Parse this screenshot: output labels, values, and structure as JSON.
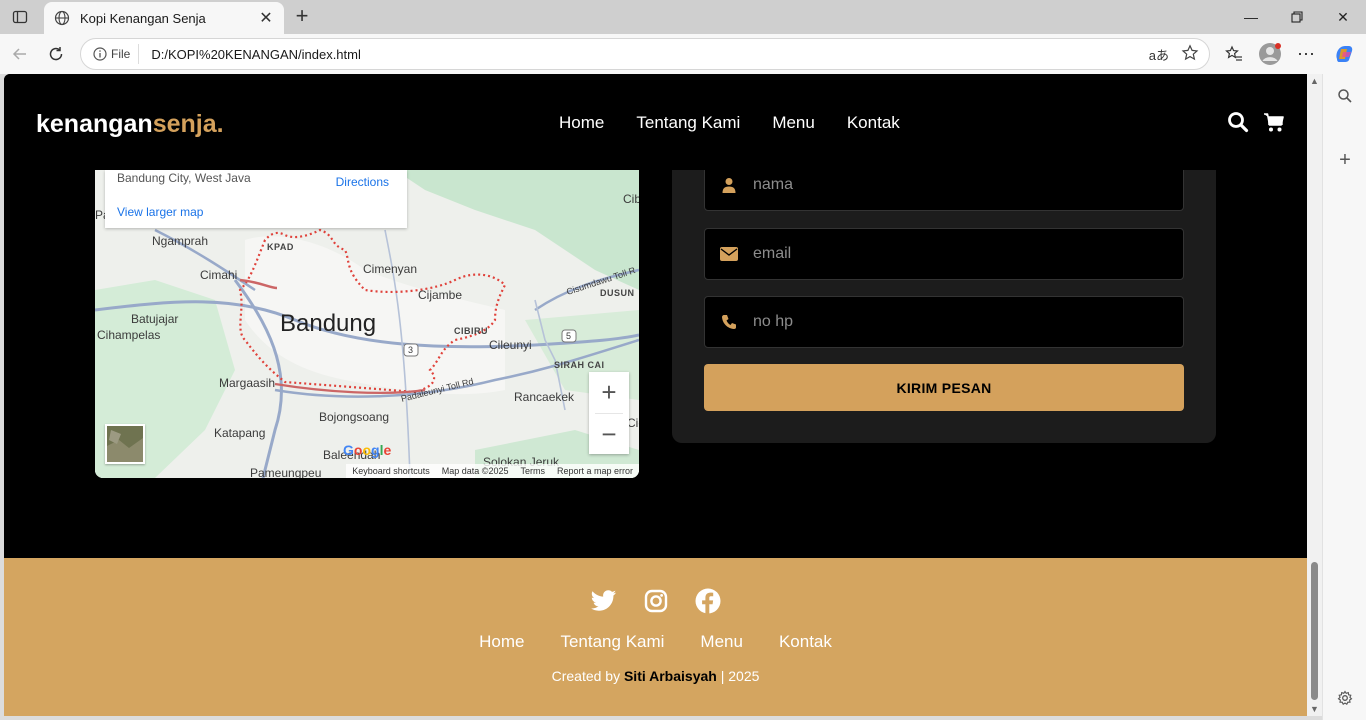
{
  "browser": {
    "tab_title": "Kopi Kenangan Senja",
    "address_label": "File",
    "url": "D:/KOPI%20KENANGAN/index.html",
    "read_aloud_glyph": "aあ"
  },
  "site": {
    "logo_main": "kenangan",
    "logo_accent": "senja.",
    "accent_color": "#d4a15c",
    "nav": [
      "Home",
      "Tentang Kami",
      "Menu",
      "Kontak"
    ]
  },
  "map": {
    "address": "Bandung City, West Java",
    "directions": "Directions",
    "larger_map": "View larger map",
    "places": {
      "pa": "Pa",
      "ngamprah": "Ngamprah",
      "kpad": "KPAD",
      "cimahi": "Cimahi",
      "cimenyan": "Cimenyan",
      "cijambe": "Cijambe",
      "bandung": "Bandung",
      "cibiru": "CIBIRU",
      "batujajar": "Batujajar",
      "cihampelas": "Cihampelas",
      "cileunyi": "Cileunyi",
      "sirah_cai": "SIRAH CAI",
      "margaasih": "Margaasih",
      "rancaekek": "Rancaekek",
      "bojongsoang": "Bojongsoang",
      "katapang": "Katapang",
      "pameungpeuk": "Pameungpeu",
      "baleendah": "Baleendah",
      "solokan_jeruk": "Solokan Jeruk",
      "cib": "Cib",
      "dusun": "DUSUN",
      "cisumdawu": "Cisumdawu Toll R",
      "padaleunyi": "Padaleunyi Toll Rd",
      "cic": "Cic",
      "route_3": "3",
      "route_5": "5"
    },
    "zoom_in": "+",
    "zoom_out": "−",
    "google": "Google",
    "attribution": [
      "Keyboard shortcuts",
      "Map data ©2025",
      "Terms",
      "Report a map error"
    ]
  },
  "form": {
    "name_placeholder": "nama",
    "email_placeholder": "email",
    "phone_placeholder": "no hp",
    "submit_label": "KIRIM PESAN"
  },
  "footer": {
    "links": [
      "Home",
      "Tentang Kami",
      "Menu",
      "Kontak"
    ],
    "credit_prefix": "Created by",
    "credit_name": "Siti Arbaisyah",
    "credit_suffix": "| 2025",
    "socials": [
      "twitter-icon",
      "instagram-icon",
      "facebook-icon"
    ],
    "bg_color": "#d4a560"
  }
}
